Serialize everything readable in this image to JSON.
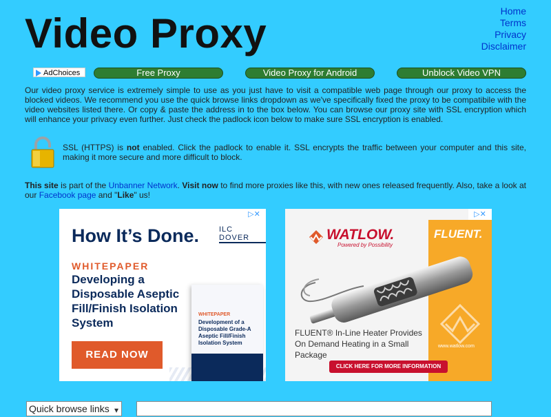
{
  "site": {
    "title": "Video Proxy"
  },
  "nav": [
    {
      "label": "Home"
    },
    {
      "label": "Terms"
    },
    {
      "label": "Privacy"
    },
    {
      "label": "Disclaimer"
    }
  ],
  "buttons": {
    "adchoices": "AdChoices",
    "free_proxy": "Free Proxy",
    "android": "Video Proxy for Android",
    "vpn": "Unblock Video VPN"
  },
  "description": "Our video proxy service is extremely simple to use as you just have to visit a compatible web page through our proxy to access the blocked videos. We recommend you use the quick browse links dropdown as we've specifically fixed the proxy to be compatibile with the video websites listed there. Or copy & paste the address in to the box below. You can browse our proxy site with SSL encryption which will enhance your privacy even further. Just check the padlock icon below to make sure SSL encryption is enabled.",
  "ssl": {
    "pre": "SSL (HTTPS) is ",
    "not": "not",
    "post": " enabled. Click the padlock to enable it. SSL encrypts the traffic between your computer and this site, making it more secure and more difficult to block."
  },
  "unbanner": {
    "this_site": "This site",
    "part_of": " is part of the ",
    "network_link": "Unbanner Network",
    "dot": ". ",
    "visit_now": "Visit now",
    "rest": " to find more proxies like this, with new ones released frequently. Also, take a look at our ",
    "facebook_link": "Facebook page",
    "and": " and \"",
    "like": "Like",
    "us": "\" us!"
  },
  "ad1": {
    "x": "▷✕",
    "headline": "How It’s Done.",
    "logo": "ILC DOVER",
    "tag": "WHITEPAPER",
    "body": "Developing a Disposable Aseptic Fill/Finish Isolation System",
    "cta": "READ NOW",
    "book_tag": "WHITEPAPER",
    "book_title": "Development of a Disposable Grade-A Aseptic Fill/Finish Isolation System"
  },
  "ad2": {
    "x": "▷✕",
    "brand": "WATLOW.",
    "brand_sub": "Powered by Possibility",
    "product": "FLUENT.",
    "caption": "FLUENT® In-Line Heater Provides On Demand Heating in a Small Package",
    "url": "www.watlow.com",
    "cta": "CLICK HERE FOR MORE INFORMATION"
  },
  "quick_browse": {
    "selected": "Quick browse links"
  },
  "url_input": {
    "value": ""
  }
}
